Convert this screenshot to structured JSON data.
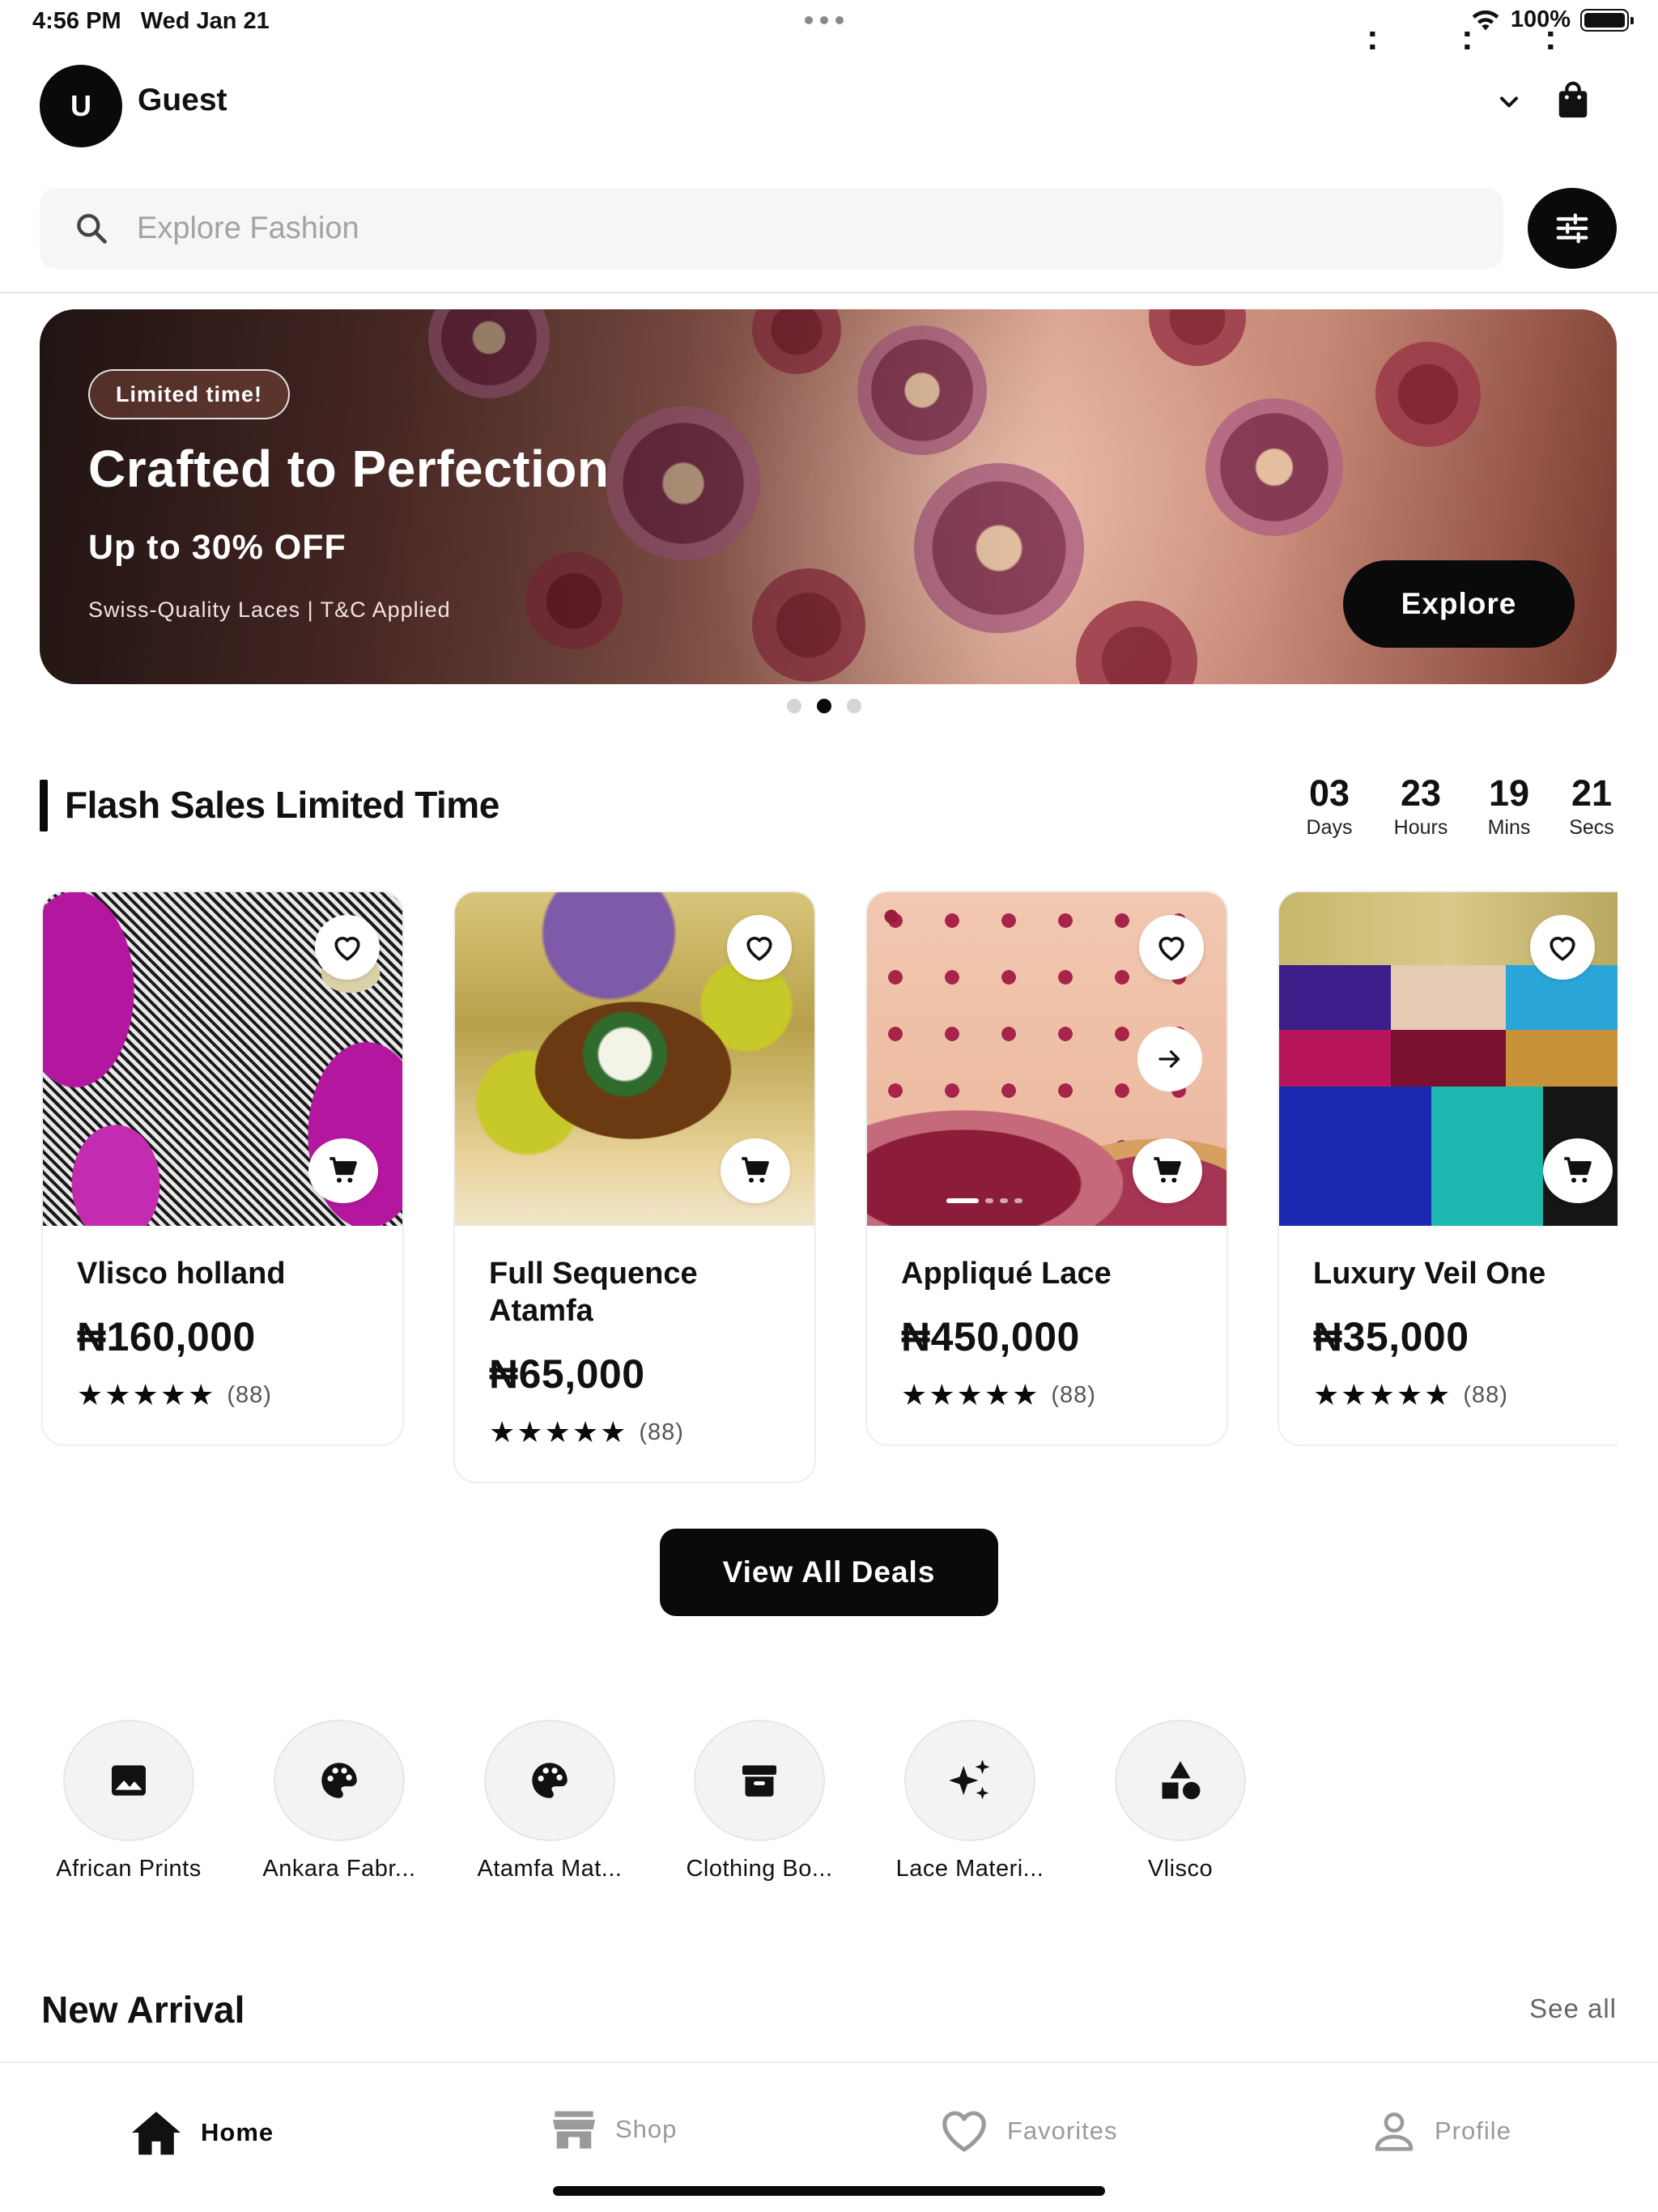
{
  "status_bar": {
    "time": "4:56 PM",
    "date": "Wed Jan 21",
    "battery": "100%"
  },
  "header": {
    "avatar_initial": "U",
    "user_name": "Guest"
  },
  "search": {
    "placeholder": "Explore Fashion"
  },
  "banner": {
    "badge": "Limited time!",
    "title": "Crafted to Perfection",
    "subtitle": "Up to 30% OFF",
    "note": "Swiss-Quality Laces | T&C Applied",
    "cta": "Explore",
    "page_index": 2,
    "page_count": 3
  },
  "flash_sales": {
    "title": "Flash Sales Limited Time",
    "timer": [
      {
        "value": "03",
        "label": "Days"
      },
      {
        "value": "23",
        "label": "Hours"
      },
      {
        "value": "19",
        "label": "Mins"
      },
      {
        "value": "21",
        "label": "Secs"
      }
    ],
    "separator": ":",
    "products": [
      {
        "name": "Vlisco holland",
        "price": "₦160,000",
        "stars": "★★★★★",
        "reviews": "(88)"
      },
      {
        "name": "Full Sequence Atamfa",
        "price": "₦65,000",
        "stars": "★★★★★",
        "reviews": "(88)"
      },
      {
        "name": "Appliqué Lace",
        "price": "₦450,000",
        "stars": "★★★★★",
        "reviews": "(88)"
      },
      {
        "name": "Luxury Veil One",
        "price": "₦35,000",
        "stars": "★★★★★",
        "reviews": "(88)"
      }
    ],
    "view_all": "View All Deals"
  },
  "categories": [
    {
      "label": "African Prints",
      "icon": "image-icon"
    },
    {
      "label": "Ankara Fabr...",
      "icon": "palette-icon"
    },
    {
      "label": "Atamfa Mat...",
      "icon": "palette-icon"
    },
    {
      "label": "Clothing Bo...",
      "icon": "archive-box-icon"
    },
    {
      "label": "Lace Materi...",
      "icon": "sparkles-icon"
    },
    {
      "label": "Vlisco",
      "icon": "shapes-icon"
    }
  ],
  "new_arrival": {
    "title": "New Arrival",
    "see_all": "See all"
  },
  "tabs": [
    {
      "label": "Home",
      "icon": "home-icon",
      "active": true
    },
    {
      "label": "Shop",
      "icon": "store-icon",
      "active": false
    },
    {
      "label": "Favorites",
      "icon": "heart-icon",
      "active": false
    },
    {
      "label": "Profile",
      "icon": "person-icon",
      "active": false
    }
  ]
}
